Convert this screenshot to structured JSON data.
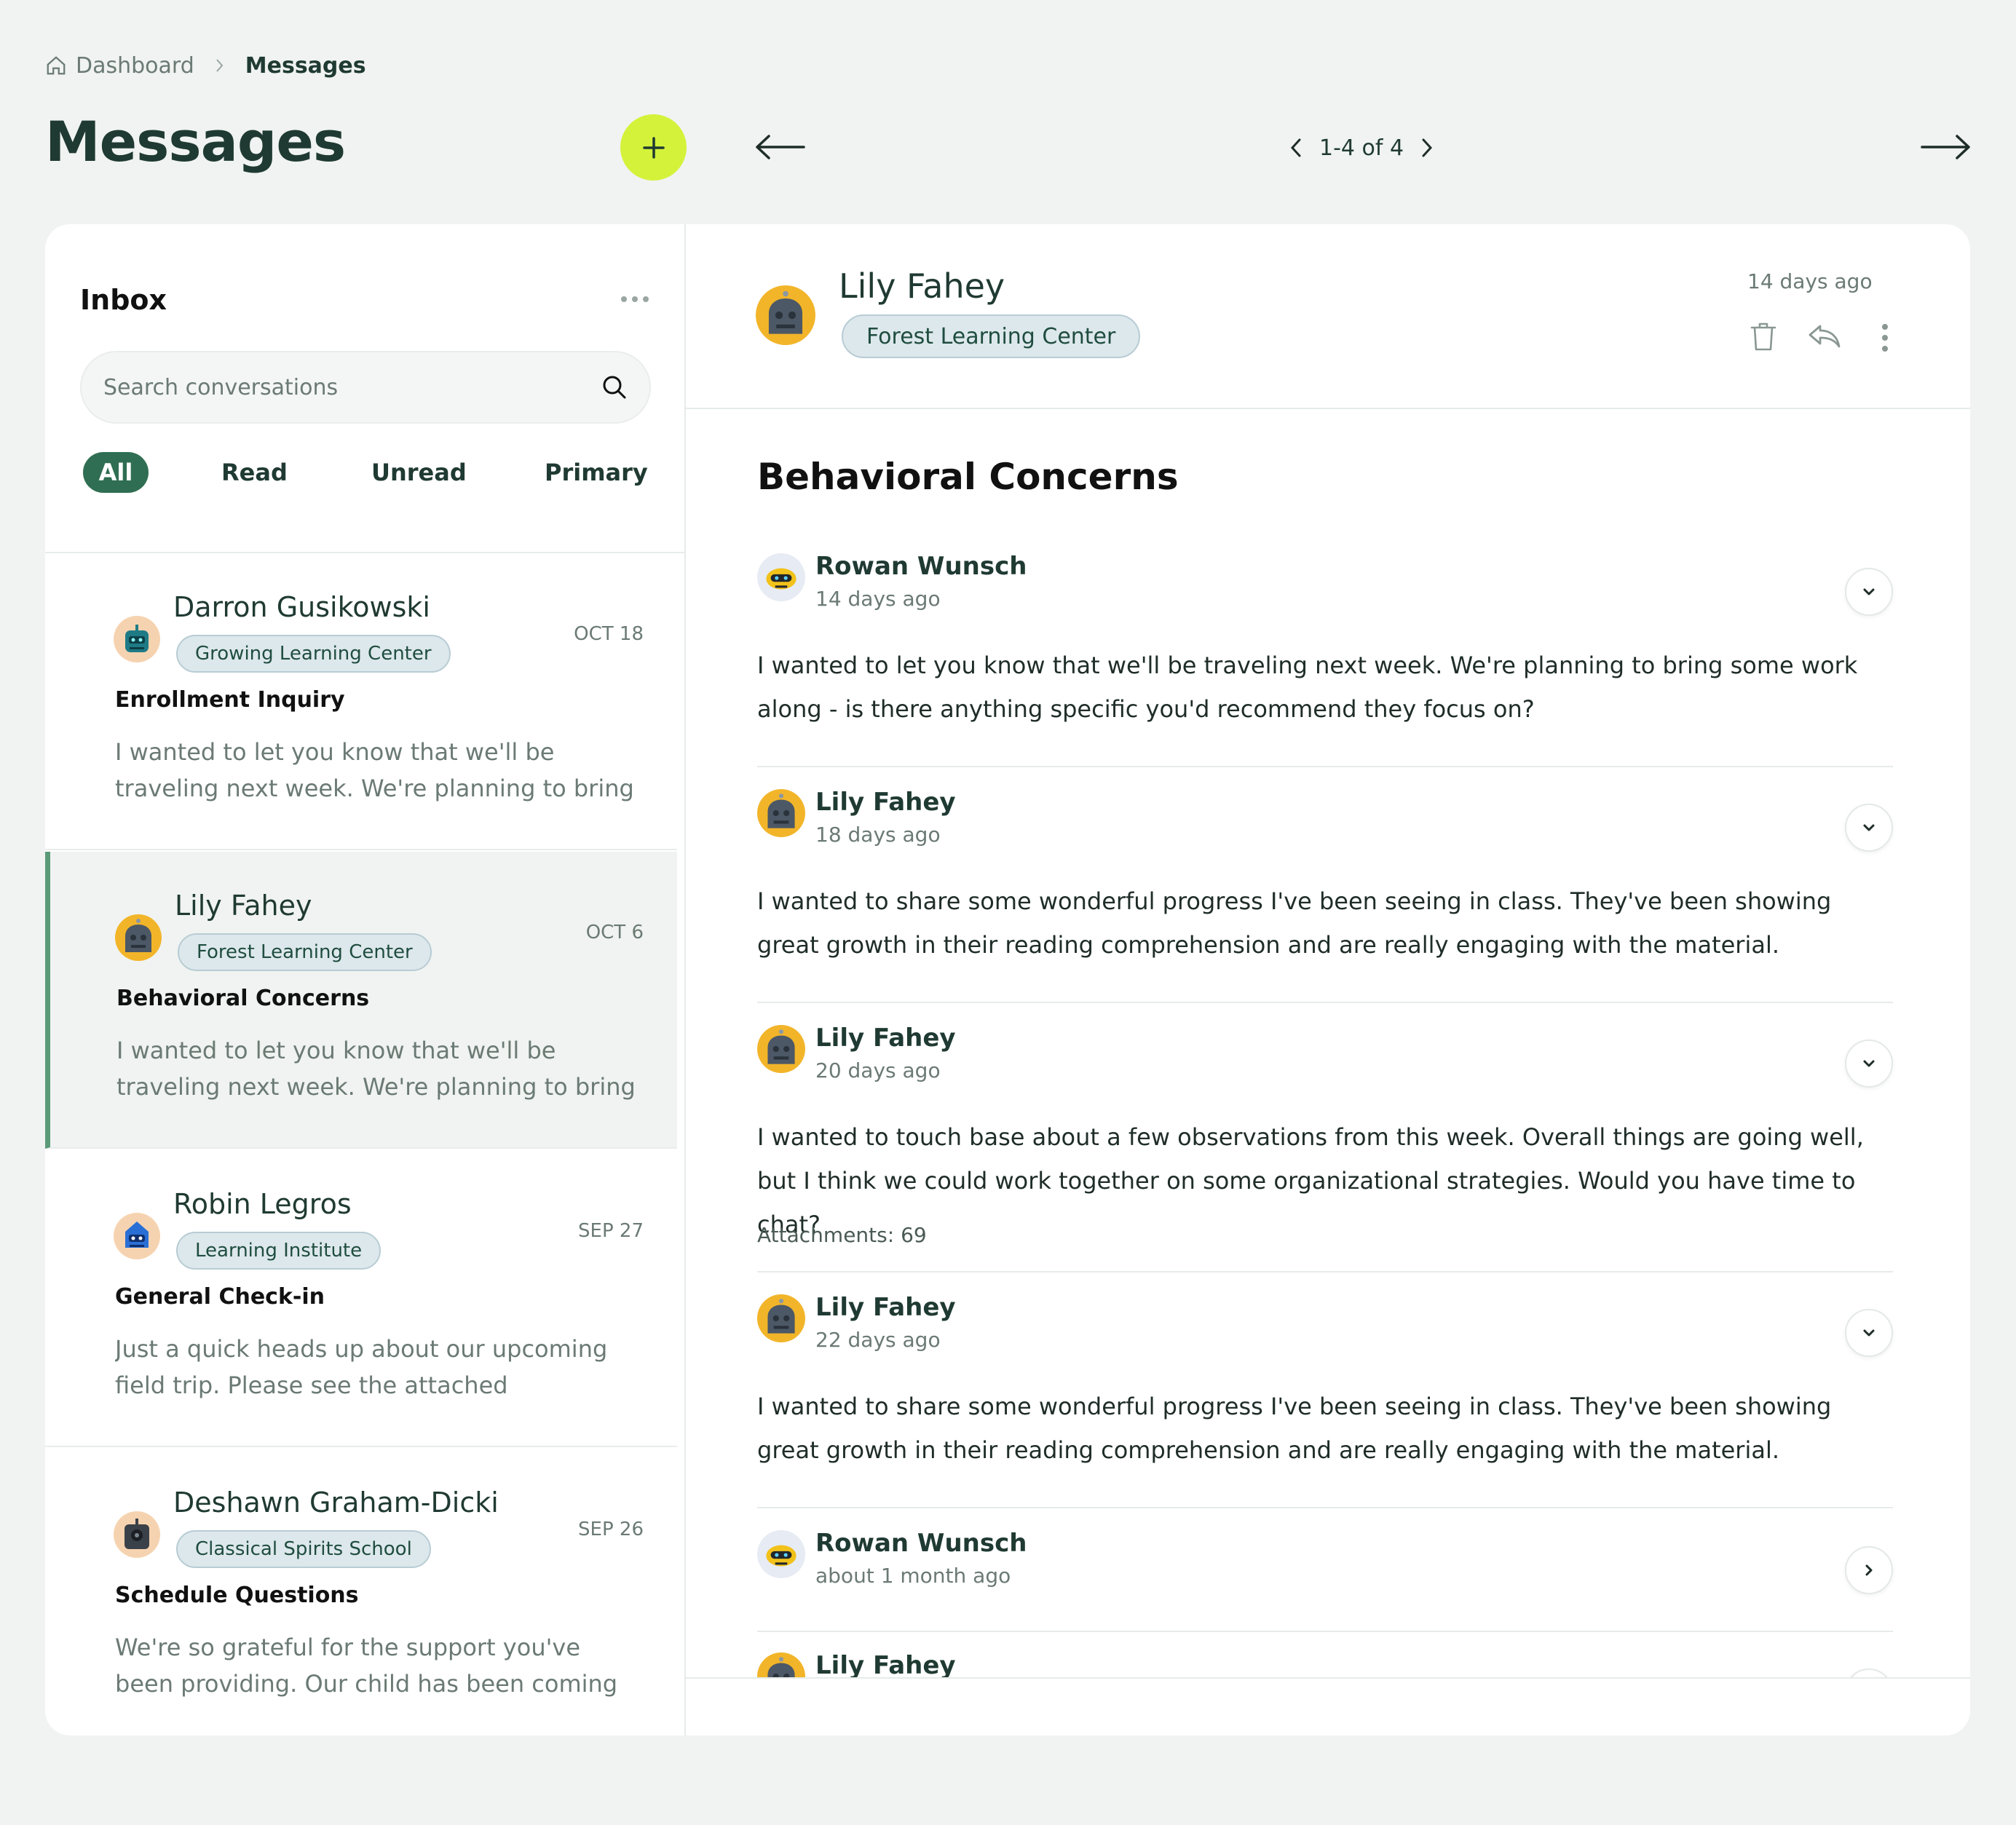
{
  "breadcrumb": {
    "home": "Dashboard",
    "current": "Messages"
  },
  "page_title": "Messages",
  "compose": {
    "label": "+"
  },
  "pager": {
    "label": "1-4 of 4"
  },
  "inbox": {
    "title": "Inbox",
    "search_placeholder": "Search conversations",
    "filters": {
      "all": "All",
      "read": "Read",
      "unread": "Unread",
      "primary": "Primary"
    },
    "conversations": [
      {
        "name": "Darron Gusikowski",
        "school": "Growing Learning Center",
        "date": "OCT 18",
        "subject": "Enrollment Inquiry",
        "preview": "I wanted to let you know that we'll be traveling next week. We're planning to bring some work...",
        "avatar": "teal-robot-icon"
      },
      {
        "name": "Lily Fahey",
        "school": "Forest Learning Center",
        "date": "OCT 6",
        "subject": "Behavioral Concerns",
        "preview": "I wanted to let you know that we'll be traveling next week. We're planning to bring some work...",
        "avatar": "gray-robot-icon",
        "selected": true
      },
      {
        "name": "Robin Legros",
        "school": "Learning Institute",
        "date": "SEP 27",
        "subject": "General Check-in",
        "preview": "Just a quick heads up about our upcoming field trip. Please see the attached permission slip an...",
        "avatar": "blue-robot-icon"
      },
      {
        "name": "Deshawn Graham-Dicki",
        "school": "Classical Spirits School",
        "date": "SEP 26",
        "subject": "Schedule Questions",
        "preview": "We're so grateful for the support you've been providing. Our child has been coming home...",
        "avatar": "dark-robot-icon"
      }
    ]
  },
  "detail": {
    "sender": "Lily Fahey",
    "school": "Forest Learning Center",
    "time": "14 days ago",
    "subject": "Behavioral Concerns",
    "messages": [
      {
        "name": "Rowan Wunsch",
        "time": "14 days ago",
        "body": "I wanted to let you know that we'll be traveling next week. We're planning to bring some work along - is there anything specific you'd recommend they focus on?",
        "expanded": true
      },
      {
        "name": "Lily Fahey",
        "time": "18 days ago",
        "body": "I wanted to share some wonderful progress I've been seeing in class. They've been showing great growth in their reading comprehension and are really engaging with the material.",
        "expanded": true
      },
      {
        "name": "Lily Fahey",
        "time": "20 days ago",
        "body": "I wanted to touch base about a few observations from this week. Overall things are going well, but I think we could work together on some organizational strategies. Would you have time to chat?",
        "attachments": "Attachments: 69",
        "expanded": true
      },
      {
        "name": "Lily Fahey",
        "time": "22 days ago",
        "body": "I wanted to share some wonderful progress I've been seeing in class. They've been showing great growth in their reading comprehension and are really engaging with the material.",
        "expanded": true
      },
      {
        "name": "Rowan Wunsch",
        "time": "about 1 month ago",
        "expanded": false
      },
      {
        "name": "Lily Fahey",
        "expanded": false
      }
    ]
  },
  "colors": {
    "accent_green": "#2f6e52",
    "compose_lime": "#d4f23a",
    "badge_bg": "#dde8ec",
    "selected_bar": "#5b9a78"
  }
}
